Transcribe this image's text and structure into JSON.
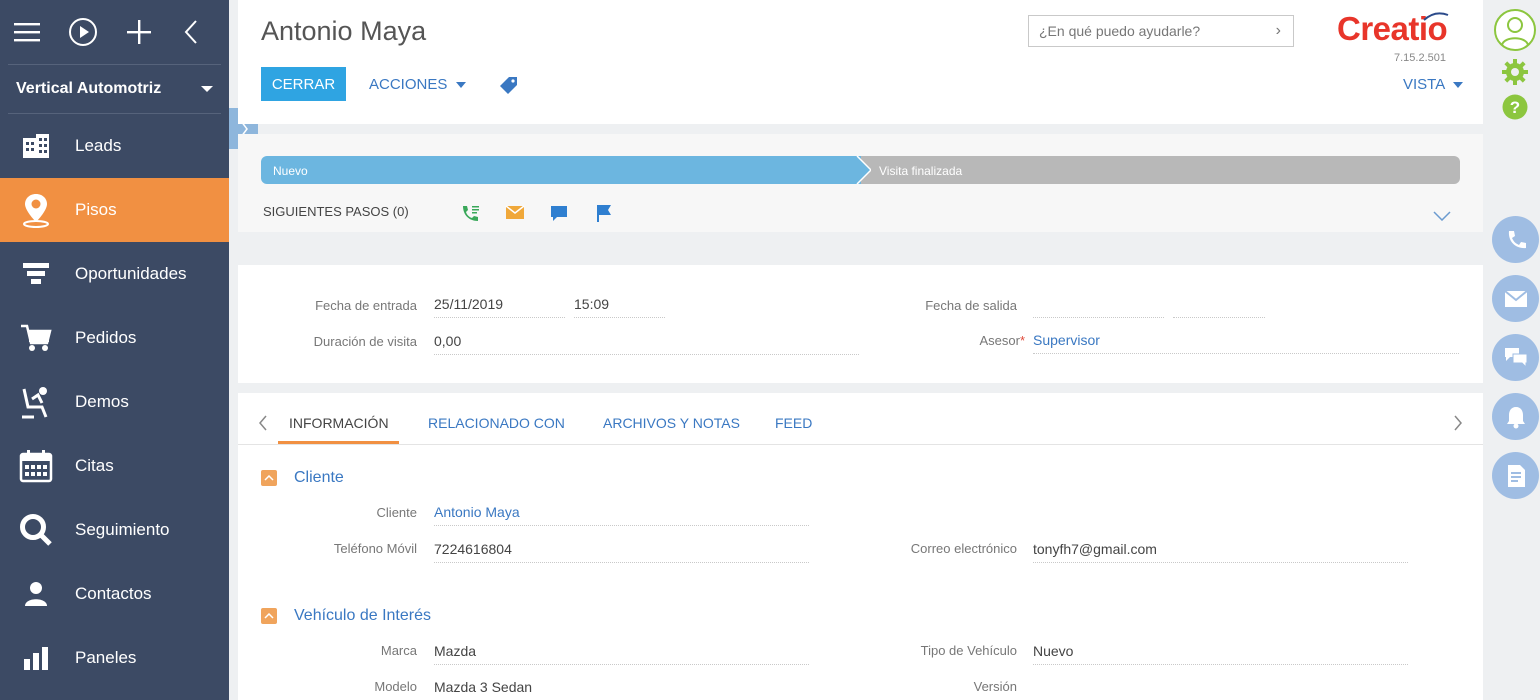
{
  "sidebar": {
    "workspace": "Vertical Automotriz",
    "items": [
      {
        "label": "Leads"
      },
      {
        "label": "Pisos"
      },
      {
        "label": "Oportunidades"
      },
      {
        "label": "Pedidos"
      },
      {
        "label": "Demos"
      },
      {
        "label": "Citas"
      },
      {
        "label": "Seguimiento"
      },
      {
        "label": "Contactos"
      },
      {
        "label": "Paneles"
      }
    ]
  },
  "header": {
    "title": "Antonio Maya",
    "search_placeholder": "¿En qué puedo ayudarle?",
    "logo": "Creatio",
    "version": "7.15.2.501",
    "close_label": "CERRAR",
    "actions_label": "ACCIONES",
    "view_label": "VISTA"
  },
  "stage": {
    "steps": [
      "Nuevo",
      "Visita finalizada"
    ],
    "next_steps": "SIGUIENTES PASOS (0)"
  },
  "fields": {
    "entry_date_label": "Fecha de entrada",
    "entry_date": "25/11/2019",
    "entry_time": "15:09",
    "exit_date_label": "Fecha de salida",
    "duration_label": "Duración de visita",
    "duration": "0,00",
    "advisor_label": "Asesor",
    "advisor": "Supervisor"
  },
  "tabs": {
    "items": [
      "INFORMACIÓN",
      "RELACIONADO CON",
      "ARCHIVOS Y NOTAS",
      "FEED"
    ]
  },
  "client": {
    "section": "Cliente",
    "client_label": "Cliente",
    "client": "Antonio Maya",
    "phone_label": "Teléfono Móvil",
    "phone": "7224616804",
    "email_label": "Correo electrónico",
    "email": "tonyfh7@gmail.com"
  },
  "vehicle": {
    "section": "Vehículo de Interés",
    "brand_label": "Marca",
    "brand": "Mazda",
    "type_label": "Tipo de Vehículo",
    "type": "Nuevo",
    "model_label": "Modelo",
    "model": "Mazda 3 Sedan",
    "version_label": "Versión"
  },
  "colors": {
    "sidebar": "#3c4a64",
    "active": "#f19042",
    "primary": "#2fa4e2",
    "link": "#3a78c2",
    "brand": "#e8352a"
  }
}
